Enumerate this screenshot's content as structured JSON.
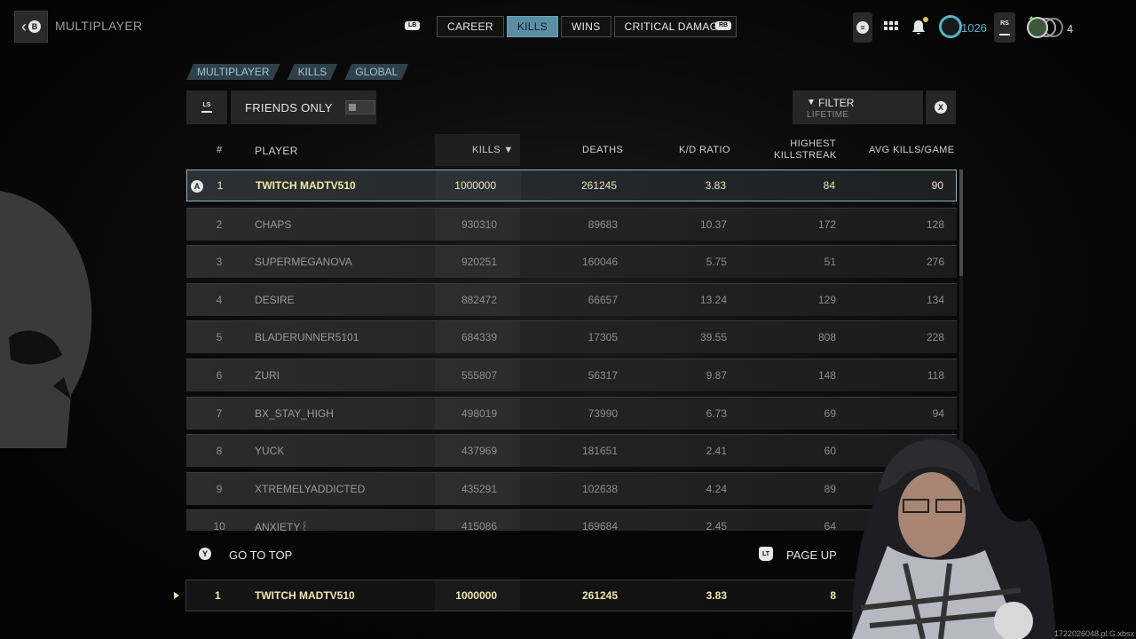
{
  "header": {
    "back_key": "B",
    "section_title": "MULTIPLAYER",
    "lb": "LB",
    "rb": "RB",
    "tabs": [
      {
        "label": "CAREER",
        "active": false
      },
      {
        "label": "KILLS",
        "active": true
      },
      {
        "label": "WINS",
        "active": false
      },
      {
        "label": "CRITICAL DAMAGE",
        "active": false
      }
    ],
    "currency": "1026",
    "rs": "RS",
    "party_count": "4"
  },
  "breadcrumb": [
    "MULTIPLAYER",
    "KILLS",
    "GLOBAL"
  ],
  "controls": {
    "ls": "LS",
    "friends_only": "FRIENDS ONLY",
    "friends_only_enabled": false,
    "filter_label": "FILTER",
    "filter_value": "LIFETIME",
    "close_key": "X"
  },
  "table": {
    "columns": [
      "#",
      "PLAYER",
      "KILLS ▼",
      "DEATHS",
      "K/D RATIO",
      "HIGHEST KILLSTREAK",
      "AVG KILLS/GAME"
    ],
    "selected_key": "A",
    "rows": [
      {
        "rank": "1",
        "player": "TWITCH MADTV510",
        "kills": "1000000",
        "deaths": "261245",
        "kd": "3.83",
        "streak": "84",
        "avg": "90"
      },
      {
        "rank": "2",
        "player": "CHAPS",
        "kills": "930310",
        "deaths": "89683",
        "kd": "10.37",
        "streak": "172",
        "avg": "128"
      },
      {
        "rank": "3",
        "player": "SUPERMEGANOVA",
        "kills": "920251",
        "deaths": "160046",
        "kd": "5.75",
        "streak": "51",
        "avg": "276"
      },
      {
        "rank": "4",
        "player": "DESIRE",
        "kills": "882472",
        "deaths": "66657",
        "kd": "13.24",
        "streak": "129",
        "avg": "134"
      },
      {
        "rank": "5",
        "player": "BLADERUNNER5101",
        "kills": "684339",
        "deaths": "17305",
        "kd": "39.55",
        "streak": "808",
        "avg": "228"
      },
      {
        "rank": "6",
        "player": "ZURI",
        "kills": "555807",
        "deaths": "56317",
        "kd": "9.87",
        "streak": "148",
        "avg": "118"
      },
      {
        "rank": "7",
        "player": "BX_STAY_HIGH",
        "kills": "498019",
        "deaths": "73990",
        "kd": "6.73",
        "streak": "69",
        "avg": "94"
      },
      {
        "rank": "8",
        "player": "YUCK",
        "kills": "437969",
        "deaths": "181651",
        "kd": "2.41",
        "streak": "60",
        "avg": ""
      },
      {
        "rank": "9",
        "player": "XTREMELYADDICTED",
        "kills": "435291",
        "deaths": "102638",
        "kd": "4.24",
        "streak": "89",
        "avg": ""
      },
      {
        "rank": "10",
        "player": "ANXIETY꒰",
        "kills": "415086",
        "deaths": "169684",
        "kd": "2.45",
        "streak": "64",
        "avg": ""
      }
    ]
  },
  "footer": {
    "go_to_top_key": "Y",
    "go_to_top": "GO TO TOP",
    "page_up_key": "LT",
    "page_up": "PAGE UP"
  },
  "my_row": {
    "rank": "1",
    "player": "TWITCH MADTV510",
    "kills": "1000000",
    "deaths": "261245",
    "kd": "3.83",
    "streak": "8"
  },
  "watermark": "1722026048.pl.G.xbsx",
  "colors": {
    "accent": "#5b8ea4",
    "highlight_text": "#f0e9a8",
    "currency": "#4fb6c8"
  }
}
